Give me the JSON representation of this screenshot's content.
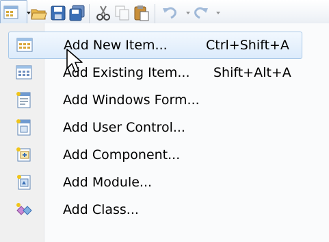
{
  "toolbar": {
    "buttons": [
      {
        "name": "add-item-icon"
      },
      {
        "name": "open-file-icon"
      },
      {
        "name": "save-icon"
      },
      {
        "name": "save-all-icon"
      },
      {
        "name": "cut-icon"
      },
      {
        "name": "copy-icon"
      },
      {
        "name": "paste-icon"
      },
      {
        "name": "undo-icon"
      },
      {
        "name": "redo-icon"
      }
    ]
  },
  "menu": {
    "items": [
      {
        "label": "Add New Item...",
        "shortcut": "Ctrl+Shift+A",
        "icon": "new-item-icon"
      },
      {
        "label": "Add Existing Item...",
        "shortcut": "Shift+Alt+A",
        "icon": "existing-item-icon"
      },
      {
        "label": "Add Windows Form...",
        "shortcut": "",
        "icon": "windows-form-icon"
      },
      {
        "label": "Add User Control...",
        "shortcut": "",
        "icon": "user-control-icon"
      },
      {
        "label": "Add Component...",
        "shortcut": "",
        "icon": "component-icon"
      },
      {
        "label": "Add Module...",
        "shortcut": "",
        "icon": "module-icon"
      },
      {
        "label": "Add Class...",
        "shortcut": "",
        "icon": "class-icon"
      }
    ]
  },
  "colors": {
    "highlight_border": "#a8c8e8",
    "highlight_fill": "#dcebfb",
    "gutter": "#f0f0f0"
  }
}
